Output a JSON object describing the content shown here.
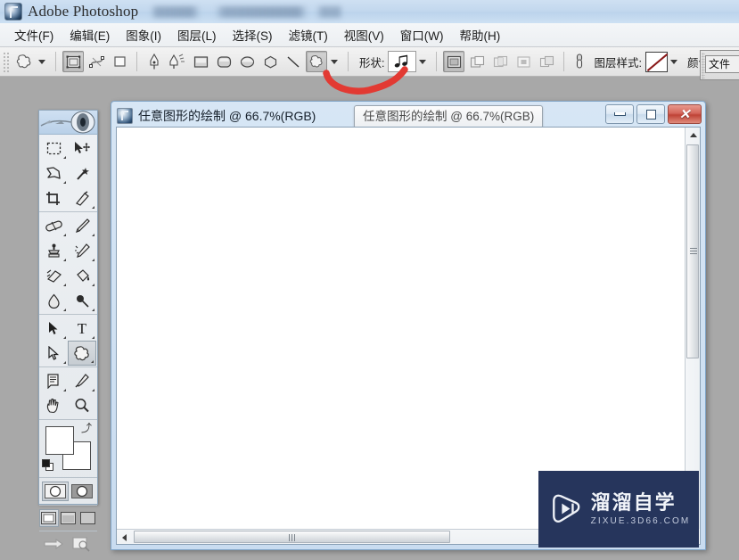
{
  "window": {
    "app_title": "Adobe Photoshop",
    "app_icon": "photoshop-icon",
    "blurred_suffix": ""
  },
  "menubar": {
    "items": [
      {
        "label": "文件(F)",
        "name": "menu-file"
      },
      {
        "label": "编辑(E)",
        "name": "menu-edit"
      },
      {
        "label": "图象(I)",
        "name": "menu-image"
      },
      {
        "label": "图层(L)",
        "name": "menu-layer"
      },
      {
        "label": "选择(S)",
        "name": "menu-select"
      },
      {
        "label": "滤镜(T)",
        "name": "menu-filter"
      },
      {
        "label": "视图(V)",
        "name": "menu-view"
      },
      {
        "label": "窗口(W)",
        "name": "menu-window"
      },
      {
        "label": "帮助(H)",
        "name": "menu-help"
      }
    ]
  },
  "options_bar": {
    "active_tool_icon": "custom-shape-tool-icon",
    "mode_buttons": [
      {
        "name": "shape-layers-mode",
        "icon": "shape-layer-icon",
        "pressed": true
      },
      {
        "name": "paths-mode",
        "icon": "path-icon",
        "pressed": false
      },
      {
        "name": "fill-pixels-mode",
        "icon": "fill-pixels-icon",
        "pressed": false
      }
    ],
    "shape_tools": [
      {
        "name": "pen-tool",
        "icon": "pen-icon"
      },
      {
        "name": "freeform-pen-tool",
        "icon": "freeform-pen-icon"
      },
      {
        "name": "rectangle-tool",
        "icon": "rectangle-icon"
      },
      {
        "name": "rounded-rectangle-tool",
        "icon": "rounded-rectangle-icon"
      },
      {
        "name": "ellipse-tool",
        "icon": "ellipse-icon"
      },
      {
        "name": "polygon-tool",
        "icon": "polygon-icon"
      },
      {
        "name": "line-tool",
        "icon": "line-icon"
      },
      {
        "name": "custom-shape-tool",
        "icon": "custom-shape-icon"
      }
    ],
    "shape_label": "形状:",
    "shape_preview_icon": "music-note-shape",
    "boolean_buttons": [
      {
        "name": "add-to-shape-area",
        "icon": "add-shape-icon",
        "pressed": true
      },
      {
        "name": "subtract-from-shape-area",
        "icon": "subtract-shape-icon",
        "pressed": false
      },
      {
        "name": "intersect-shape-areas",
        "icon": "intersect-shape-icon",
        "pressed": false
      },
      {
        "name": "exclude-overlapping-areas",
        "icon": "exclude-shape-icon",
        "pressed": false
      },
      {
        "name": "combine-shape-areas",
        "icon": "combine-shape-icon",
        "pressed": false
      }
    ],
    "link_icon": "chain-link-icon",
    "layer_style_label": "图层样式:",
    "layer_style_value": "none",
    "color_label": "颜色:",
    "color_value": "#fdfdfd"
  },
  "right_palette": {
    "tab_label": "文件"
  },
  "toolbox": {
    "header_icon": "photoshop-toolbox-banner",
    "groups": [
      {
        "name": "selection-group",
        "tools": [
          {
            "name": "rectangular-marquee-tool",
            "icon": "marquee-icon",
            "has_submenu": true
          },
          {
            "name": "move-tool",
            "icon": "move-icon",
            "has_submenu": false
          },
          {
            "name": "lasso-tool",
            "icon": "lasso-icon",
            "has_submenu": true
          },
          {
            "name": "magic-wand-tool",
            "icon": "magic-wand-icon",
            "has_submenu": false
          },
          {
            "name": "crop-tool",
            "icon": "crop-icon",
            "has_submenu": false
          },
          {
            "name": "slice-tool",
            "icon": "slice-icon",
            "has_submenu": true
          }
        ]
      },
      {
        "name": "retouch-paint-group",
        "tools": [
          {
            "name": "healing-brush-tool",
            "icon": "healing-brush-icon",
            "has_submenu": true
          },
          {
            "name": "brush-tool",
            "icon": "brush-icon",
            "has_submenu": true
          },
          {
            "name": "clone-stamp-tool",
            "icon": "clone-stamp-icon",
            "has_submenu": true
          },
          {
            "name": "history-brush-tool",
            "icon": "history-brush-icon",
            "has_submenu": true
          },
          {
            "name": "eraser-tool",
            "icon": "eraser-icon",
            "has_submenu": true
          },
          {
            "name": "paint-bucket-tool",
            "icon": "paint-bucket-icon",
            "has_submenu": true
          },
          {
            "name": "blur-tool",
            "icon": "blur-drop-icon",
            "has_submenu": true
          },
          {
            "name": "dodge-tool",
            "icon": "dodge-icon",
            "has_submenu": true
          }
        ]
      },
      {
        "name": "vector-type-group",
        "tools": [
          {
            "name": "path-selection-tool",
            "icon": "path-select-arrow-icon",
            "has_submenu": true
          },
          {
            "name": "type-tool",
            "icon": "type-t-icon",
            "has_submenu": true
          },
          {
            "name": "pen-tool",
            "icon": "pen-nib-icon",
            "has_submenu": true
          },
          {
            "name": "custom-shape-tool",
            "icon": "custom-shape-icon",
            "has_submenu": true,
            "selected": true
          }
        ]
      },
      {
        "name": "notes-view-group",
        "tools": [
          {
            "name": "notes-tool",
            "icon": "notes-icon",
            "has_submenu": true
          },
          {
            "name": "eyedropper-tool",
            "icon": "eyedropper-icon",
            "has_submenu": true
          },
          {
            "name": "hand-tool",
            "icon": "hand-icon",
            "has_submenu": false
          },
          {
            "name": "zoom-tool",
            "icon": "magnifier-icon",
            "has_submenu": false
          }
        ]
      }
    ],
    "foreground_color": "#ffffff",
    "background_color": "#ffffff",
    "mask_modes": [
      {
        "name": "standard-mask-mode",
        "icon": "standard-mode-icon",
        "selected": true
      },
      {
        "name": "quick-mask-mode",
        "icon": "quick-mask-icon",
        "selected": false
      }
    ],
    "screen_modes": [
      {
        "name": "standard-screen-mode",
        "icon": "standard-screen-icon",
        "selected": true
      },
      {
        "name": "full-screen-with-menubar",
        "icon": "fullscreen-menubar-icon",
        "selected": false
      },
      {
        "name": "full-screen-mode",
        "icon": "fullscreen-icon",
        "selected": false
      }
    ],
    "bottom_buttons": [
      {
        "name": "jump-to-imageready-button",
        "icon": "jump-to-icon"
      },
      {
        "name": "preview-in-browser-button",
        "icon": "preview-icon"
      }
    ]
  },
  "document": {
    "title": "任意图形的绘制 @ 66.7%(RGB)",
    "tooltip": "任意图形的绘制 @ 66.7%(RGB)",
    "zoom": "66.7%",
    "color_mode": "RGB",
    "controls": {
      "minimize": "minimize-button",
      "restore": "restore-button",
      "close": "close-button"
    }
  },
  "annotation": {
    "type": "red-curve-underline",
    "color": "#e23a33",
    "target": "shape-preview-picker"
  },
  "watermark": {
    "cn": "溜溜自学",
    "en": "ZIXUE.3D66.COM",
    "logo_icon": "play-button-logo",
    "bg_color": "#26355c"
  }
}
